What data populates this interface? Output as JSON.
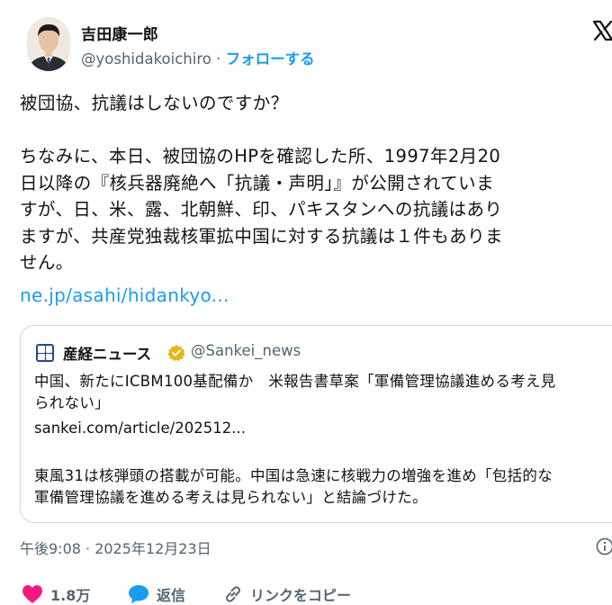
{
  "author": {
    "name": "吉田康一郎",
    "handle": "@yoshidakoichiro",
    "separator": " · ",
    "follow_label": "フォローする"
  },
  "tweet": {
    "text": "被団協、抗議はしないのですか？\n\nちなみに、本日、被団協のHPを確認した所、1997年2月20\n日以降の『核兵器廃絶へ「抗議・声明」』が公開されていま\nすが、日、米、露、北朝鮮、印、パキスタンへの抗議はあり\nますが、共産党独裁核軍拡中国に対する抗議は１件もありま\nせん。",
    "link": "ne.jp/asahi/hidankyo..."
  },
  "quote": {
    "name": "産経ニュース",
    "handle": "@Sankei_news",
    "text": "中国、新たにICBM100基配備か　米報告書草案「軍備管理協議進める考え見\nられない」",
    "link": "sankei.com/article/202512...",
    "text2": "東風31は核弾頭の搭載が可能。中国は急速に核戦力の増強を進め「包括的な\n軍備管理協議を進める考えは見られない」と結論づけた。"
  },
  "timestamp": "午後9:08 · 2025年12月23日",
  "actions": {
    "likes": "1.8万",
    "reply": "返信",
    "copy_link": "リンクをコピー"
  },
  "colors": {
    "link": "#1d9bf0",
    "like": "#f91880",
    "muted": "#536471",
    "verified": "#e2b719"
  },
  "icons": [
    "x-logo-icon",
    "verified-gold-badge-icon",
    "info-icon",
    "heart-icon",
    "reply-bubble-icon",
    "link-icon"
  ]
}
